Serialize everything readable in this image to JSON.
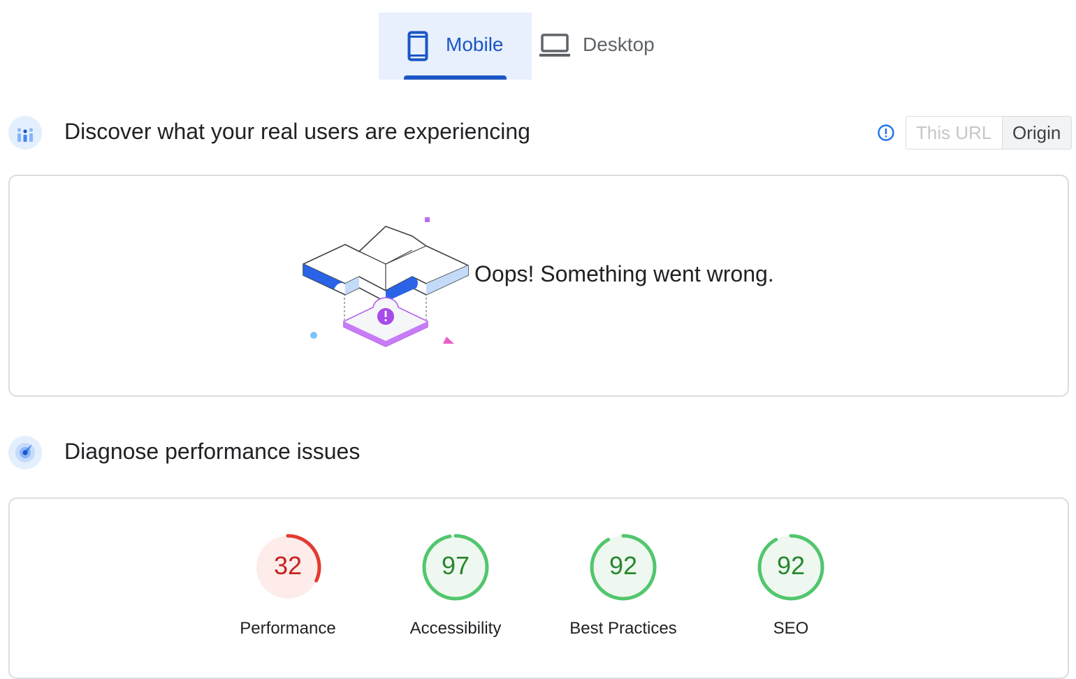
{
  "tabs": [
    {
      "label": "Mobile",
      "icon": "smartphone-icon",
      "selected": true
    },
    {
      "label": "Desktop",
      "icon": "laptop-icon",
      "selected": false
    }
  ],
  "crux": {
    "title": "Discover what your real users are experiencing",
    "toggle": {
      "options": [
        "This URL",
        "Origin"
      ],
      "selected": "Origin"
    },
    "error_message": "Oops! Something went wrong."
  },
  "diagnose": {
    "title": "Diagnose performance issues",
    "scores": [
      {
        "label": "Performance",
        "score": 32,
        "status": "fail"
      },
      {
        "label": "Accessibility",
        "score": 97,
        "status": "pass"
      },
      {
        "label": "Best Practices",
        "score": 92,
        "status": "pass"
      },
      {
        "label": "SEO",
        "score": 92,
        "status": "pass"
      }
    ]
  },
  "colors": {
    "accent": "#1a56c4",
    "tab_selected_bg": "#e8f0fe",
    "fail": "#e33a2f",
    "fail_text": "#c5221f",
    "fail_bg": "#fdecea",
    "pass": "#52c66d",
    "pass_text": "#28862e",
    "pass_bg": "#eef8f0"
  }
}
